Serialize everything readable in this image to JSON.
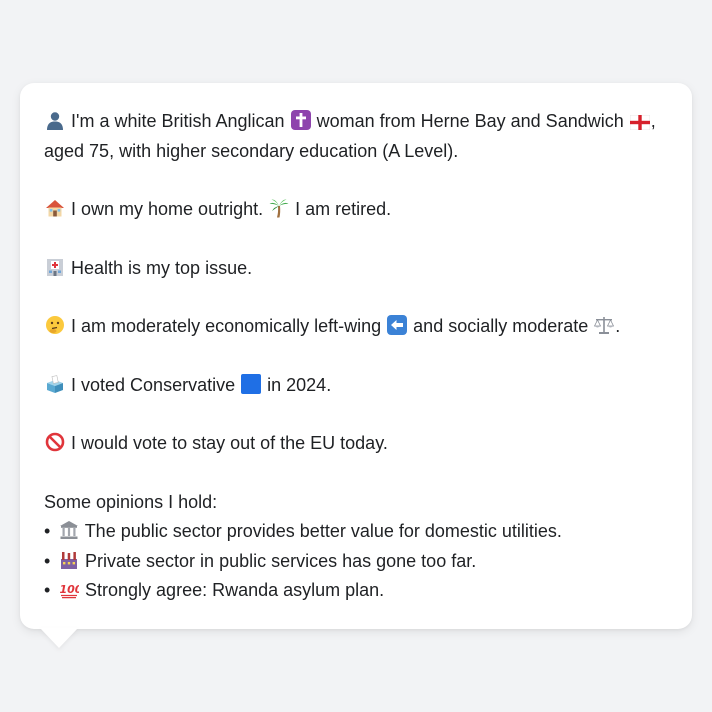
{
  "profile": {
    "identity_before": "I'm a white British Anglican",
    "identity_middle": "woman from Herne Bay and Sandwich",
    "identity_after": ",",
    "identity_line2": "aged 75, with higher secondary education (A Level).",
    "housing_before": "I own my home outright.",
    "housing_after": "I am retired.",
    "issue": "Health is my top issue.",
    "politics_before": "I am moderately economically left-wing",
    "politics_middle": "and socially moderate",
    "politics_after": ".",
    "vote_before": "I voted Conservative",
    "vote_after": "in 2024.",
    "eu": "I would vote to stay out of the EU today.",
    "opinions_heading": "Some opinions I hold:",
    "opinions": [
      "The public sector provides better value for domestic utilities.",
      "Private sector in public services has gone too far.",
      "Strongly agree: Rwanda asylum plan."
    ],
    "bullet": "•"
  },
  "icons": {
    "person": "person-silhouette-icon",
    "cross": "latin-cross-icon",
    "flag": "england-flag-icon",
    "house": "house-icon",
    "palm": "palm-tree-icon",
    "hospital": "hospital-icon",
    "thinking": "thinking-face-icon",
    "left_arrow": "left-arrow-icon",
    "scales": "balance-scale-icon",
    "ballot": "ballot-box-icon",
    "blue_square": "blue-square-icon",
    "no_entry": "prohibited-icon",
    "classical": "classical-building-icon",
    "factory": "factory-icon",
    "hundred": "hundred-points-icon"
  },
  "colors": {
    "background": "#f2f3f5",
    "card": "#ffffff",
    "text": "#1f2124",
    "conservative_blue": "#1f6fe5"
  }
}
